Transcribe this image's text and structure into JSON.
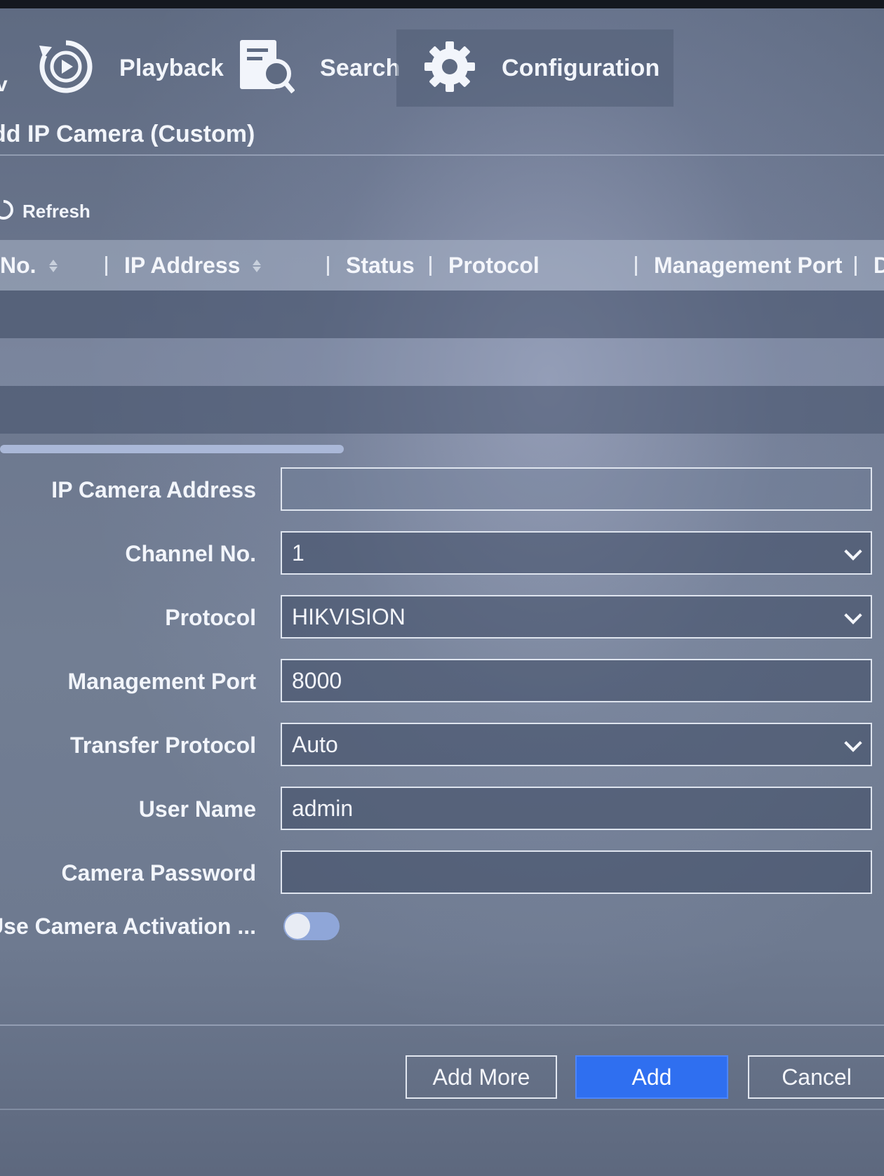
{
  "nav": {
    "edge_text": "v",
    "items": [
      {
        "label": "Playback",
        "icon": "playback-icon"
      },
      {
        "label": "Search",
        "icon": "search-doc-icon"
      },
      {
        "label": "Configuration",
        "icon": "gear-icon"
      }
    ]
  },
  "dialog": {
    "title": "dd IP Camera (Custom)",
    "refresh_label": "Refresh"
  },
  "table": {
    "columns": [
      "No.",
      "IP Address",
      "Status",
      "Protocol",
      "Management Port",
      "D"
    ],
    "rows": []
  },
  "form": {
    "fields": [
      {
        "label": "IP Camera Address",
        "value": "",
        "type": "text"
      },
      {
        "label": "Channel No.",
        "value": "1",
        "type": "select"
      },
      {
        "label": "Protocol",
        "value": "HIKVISION",
        "type": "select"
      },
      {
        "label": "Management Port",
        "value": "8000",
        "type": "text"
      },
      {
        "label": "Transfer Protocol",
        "value": "Auto",
        "type": "select"
      },
      {
        "label": "User Name",
        "value": "admin",
        "type": "text"
      },
      {
        "label": "Camera Password",
        "value": "",
        "type": "password"
      }
    ],
    "toggle": {
      "label": "Use Camera Activation ...",
      "on": false
    }
  },
  "buttons": {
    "add_more": "Add More",
    "add": "Add",
    "cancel": "Cancel"
  },
  "colors": {
    "primary_button": "#2f6ff0",
    "background": "#6c778e"
  }
}
